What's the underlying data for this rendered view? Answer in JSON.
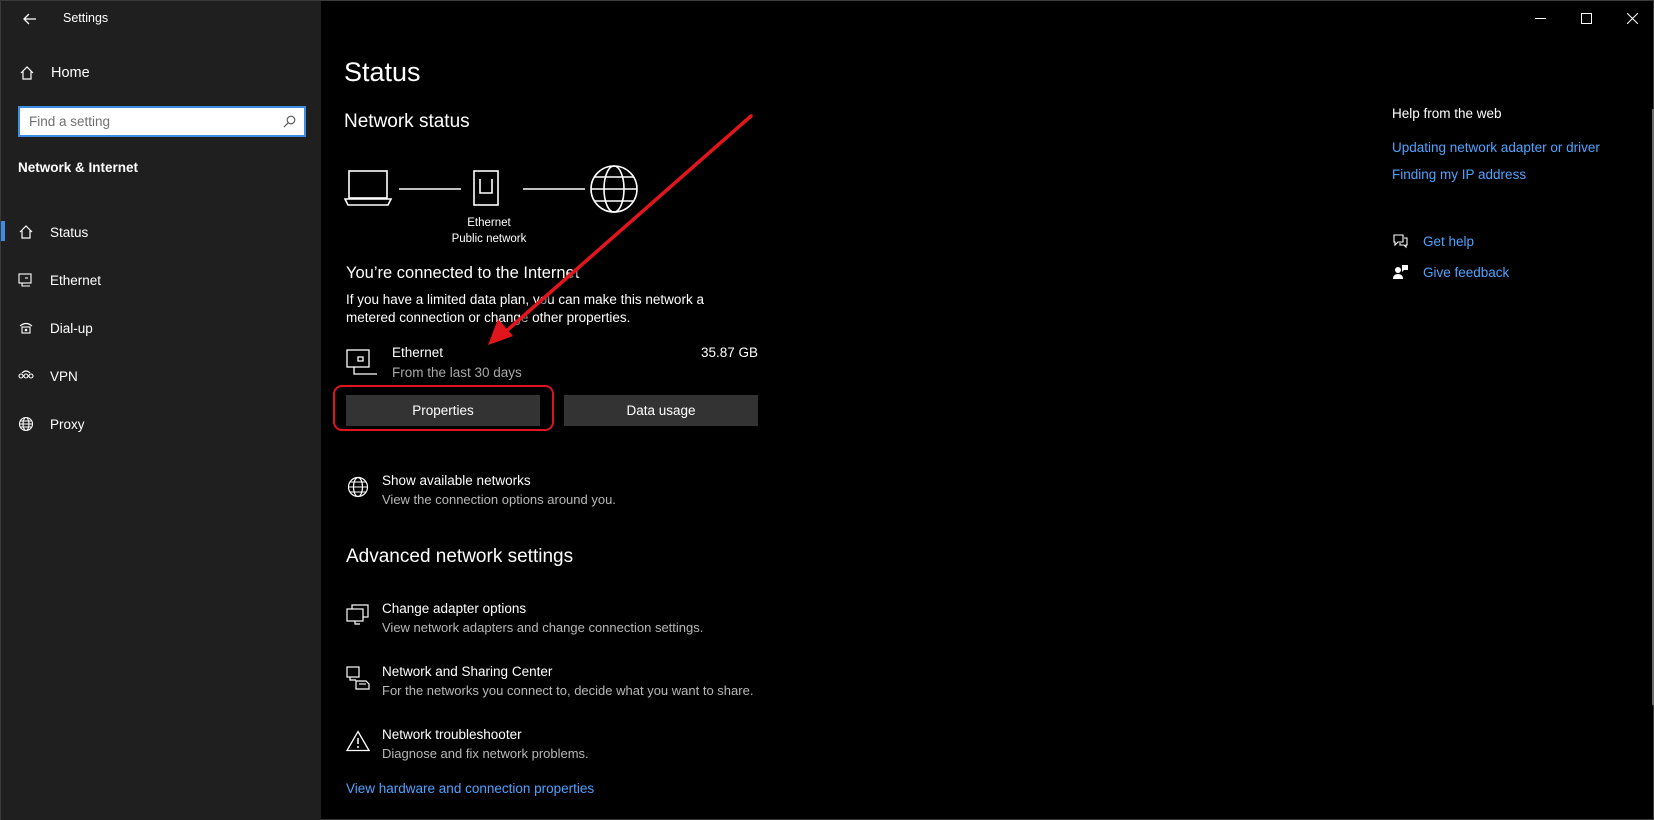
{
  "window": {
    "title": "Settings"
  },
  "sidebar": {
    "home_label": "Home",
    "search_placeholder": "Find a setting",
    "section_title": "Network & Internet",
    "items": [
      {
        "label": "Status",
        "icon": "home-status-icon",
        "active": true
      },
      {
        "label": "Ethernet",
        "icon": "ethernet-icon",
        "active": false
      },
      {
        "label": "Dial-up",
        "icon": "dialup-icon",
        "active": false
      },
      {
        "label": "VPN",
        "icon": "vpn-icon",
        "active": false
      },
      {
        "label": "Proxy",
        "icon": "globe-icon",
        "active": false
      }
    ]
  },
  "main": {
    "title": "Status",
    "network_status_title": "Network status",
    "diagram": {
      "caption_line1": "Ethernet",
      "caption_line2": "Public network"
    },
    "connected_title": "You’re connected to the Internet",
    "connected_desc": "If you have a limited data plan, you can make this network a metered connection or change other properties.",
    "ethernet": {
      "name": "Ethernet",
      "sub": "From the last 30 days",
      "size": "35.87 GB"
    },
    "buttons": {
      "properties": "Properties",
      "data_usage": "Data usage"
    },
    "show_networks": {
      "title": "Show available networks",
      "desc": "View the connection options around you."
    },
    "advanced_title": "Advanced network settings",
    "advanced_items": [
      {
        "title": "Change adapter options",
        "desc": "View network adapters and change connection settings."
      },
      {
        "title": "Network and Sharing Center",
        "desc": "For the networks you connect to, decide what you want to share."
      },
      {
        "title": "Network troubleshooter",
        "desc": "Diagnose and fix network problems."
      }
    ],
    "bottom_link": "View hardware and connection properties"
  },
  "help": {
    "title": "Help from the web",
    "links": [
      "Updating network adapter or driver",
      "Finding my IP address"
    ],
    "get_help": "Get help",
    "give_feedback": "Give feedback"
  },
  "colors": {
    "accent": "#3c8ee2",
    "link": "#4ea3ff",
    "annotation": "#e0141e",
    "sidebar_bg": "#1f1f1f",
    "button_bg": "#333333"
  }
}
